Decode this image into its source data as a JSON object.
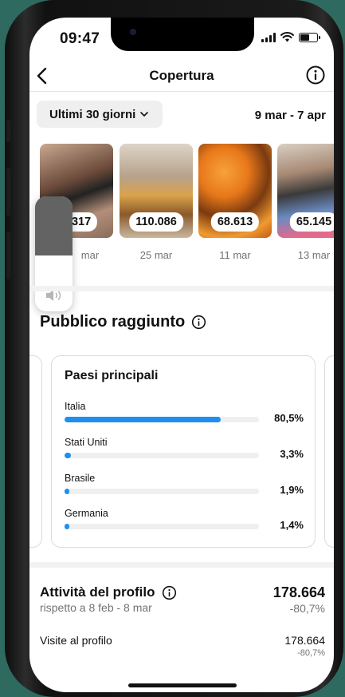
{
  "status_bar": {
    "time": "09:47"
  },
  "header": {
    "title": "Copertura"
  },
  "filter": {
    "range_label": "Ultimi 30 giorni",
    "date_range": "9 mar - 7 apr"
  },
  "thumbnails": [
    {
      "value": "9.317",
      "date": "mar"
    },
    {
      "value": "110.086",
      "date": "25 mar"
    },
    {
      "value": "68.613",
      "date": "11 mar"
    },
    {
      "value": "65.145",
      "date": "13 mar"
    }
  ],
  "audience": {
    "title": "Pubblico raggiunto",
    "card_title": "Paesi principali",
    "countries": [
      {
        "name": "Italia",
        "pct": "80,5%",
        "fraction": 0.805
      },
      {
        "name": "Stati Uniti",
        "pct": "3,3%",
        "fraction": 0.033
      },
      {
        "name": "Brasile",
        "pct": "1,9%",
        "fraction": 0.019
      },
      {
        "name": "Germania",
        "pct": "1,4%",
        "fraction": 0.014
      }
    ]
  },
  "profile_activity": {
    "title": "Attività del profilo",
    "subtitle": "rispetto a 8 feb - 8 mar",
    "value": "178.664",
    "change": "-80,7%",
    "visits_label": "Visite al profilo",
    "visits_value": "178.664",
    "visits_change": "-80,7%"
  },
  "colors": {
    "accent": "#1e8ff0",
    "background": "#2e6a5f"
  },
  "icons": [
    "back-arrow-icon",
    "info-icon",
    "chevron-down-icon",
    "volume-icon",
    "wifi-icon",
    "signal-icon",
    "battery-icon"
  ]
}
